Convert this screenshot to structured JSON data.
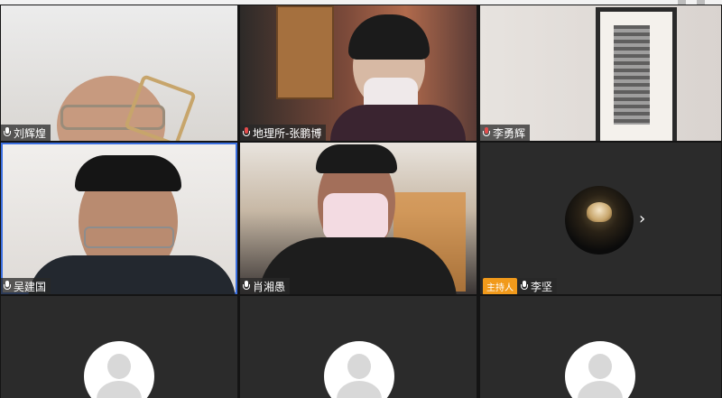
{
  "participants": [
    {
      "name": "刘辉煌",
      "muted": false,
      "host": false
    },
    {
      "name": "地理所-张鹏博",
      "muted": true,
      "host": false
    },
    {
      "name": "李勇辉",
      "muted": true,
      "host": false
    },
    {
      "name": "吴建国",
      "muted": false,
      "host": false
    },
    {
      "name": "肖湘愚",
      "muted": false,
      "host": false
    },
    {
      "name": "李坚",
      "muted": false,
      "host": true,
      "host_label": "主持人"
    }
  ],
  "colors": {
    "active_border": "#3b6fe0",
    "host_badge": "#f19a1b",
    "tile_bg": "#2b2b2b"
  },
  "icons": [
    "microphone-icon",
    "microphone-muted-icon",
    "chevron-right-icon",
    "default-avatar-icon"
  ]
}
